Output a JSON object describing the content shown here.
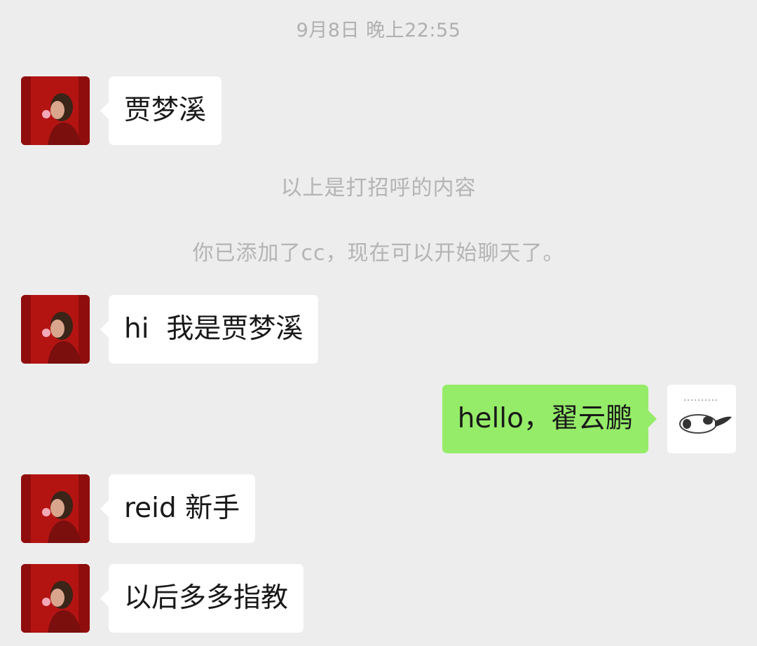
{
  "timestamp": "9月8日 晚上22:55",
  "system_messages": [
    "以上是打招呼的内容",
    "你已添加了cc，现在可以开始聊天了。"
  ],
  "messages": [
    {
      "side": "incoming",
      "text": "贾梦溪",
      "avatar": "red-portrait-avatar"
    },
    {
      "side": "incoming",
      "text": "hi  我是贾梦溪",
      "avatar": "red-portrait-avatar"
    },
    {
      "side": "outgoing",
      "text": "hello，翟云鹏",
      "avatar": "cartoon-animal-avatar"
    },
    {
      "side": "incoming",
      "text": "reid 新手",
      "avatar": "red-portrait-avatar"
    },
    {
      "side": "incoming",
      "text": "以后多多指教",
      "avatar": "red-portrait-avatar"
    }
  ],
  "colors": {
    "background": "#ededed",
    "incoming_bubble": "#ffffff",
    "outgoing_bubble": "#95ec69",
    "system_text": "#b4b4b4",
    "avatar_red": "#b11513"
  }
}
